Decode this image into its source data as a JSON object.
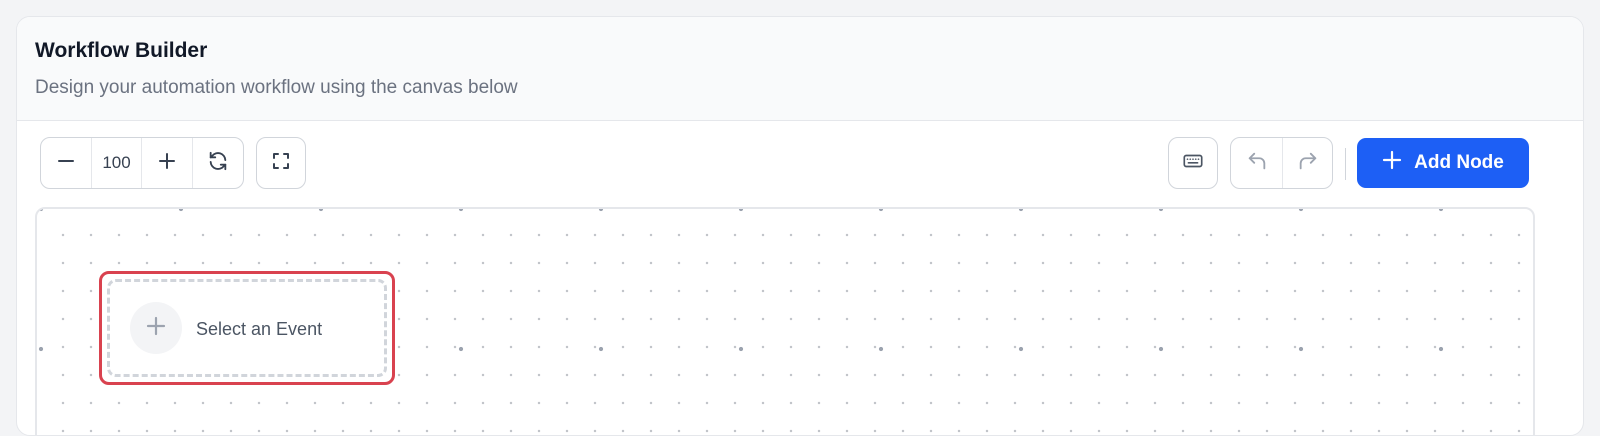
{
  "header": {
    "title": "Workflow Builder",
    "subtitle": "Design your automation workflow using the canvas below"
  },
  "toolbar": {
    "zoom_value": "100",
    "add_node_label": "Add Node",
    "icons": {
      "zoom_out": "minus-icon",
      "zoom_in": "plus-icon",
      "reset": "refresh-icon",
      "fit": "fullscreen-icon",
      "shortcuts": "keyboard-icon",
      "undo": "undo-icon",
      "redo": "redo-icon",
      "add": "plus-icon"
    }
  },
  "canvas": {
    "node": {
      "label": "Select an Event",
      "icon": "plus-icon"
    }
  },
  "colors": {
    "accent": "#1d5ff5",
    "selection": "#d9424f",
    "title_text": "#111827",
    "muted_text": "#6b7280"
  }
}
